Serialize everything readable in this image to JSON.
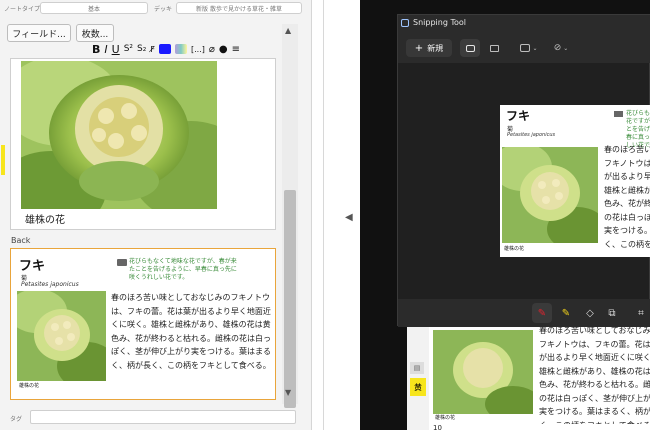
{
  "editor": {
    "notetype_label": "ノートタイプ",
    "notetype_value": "基本",
    "deck_label": "デッキ",
    "deck_value": "新版 散歩で見かける草花・雑草",
    "fields_button": "フィールド...",
    "cards_button": "枚数...",
    "front_caption": "雄株の花",
    "back_label": "Back",
    "tags_label": "タグ"
  },
  "card": {
    "title": "フキ",
    "family": "菊",
    "latin": "Petasites japonicus",
    "note": "花びらもなくて地味な花ですが、春が来たことを告げるように、早春に真っ先に咲くうれしい花です。",
    "caption": "雄株の花",
    "body": "春のほろ苦い味としておなじみのフキノトウは、フキの蕾。花は葉が出るより早く地面近くに咲く。雄株と雌株があり、雄株の花は黄色み、花が終わると枯れる。雌株の花は白っぽく、茎が伸び上がり実をつける。葉はまるく、柄が長く、この柄をフキとして食べる。"
  },
  "snipping": {
    "app_title": "Snipping Tool",
    "new_button": "新規"
  },
  "behind": {
    "page_number": "10",
    "yellow_tag": "黄"
  },
  "colors": {
    "accent_green": "#3a8c3a",
    "field_highlight": "#e9a53b",
    "snip_accent": "#e2232e"
  }
}
